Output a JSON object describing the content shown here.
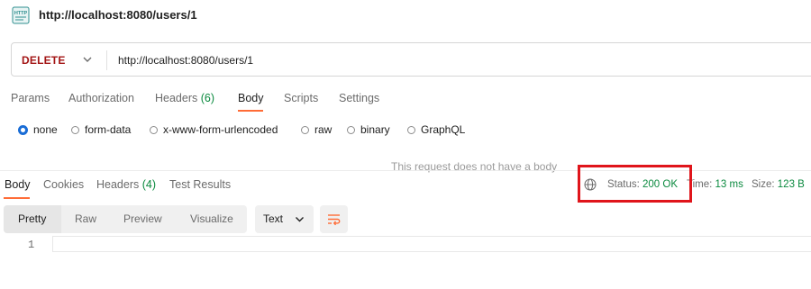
{
  "title": "http://localhost:8080/users/1",
  "request": {
    "method": "DELETE",
    "url": "http://localhost:8080/users/1",
    "tabs": {
      "params": "Params",
      "authorization": "Authorization",
      "headers_label": "Headers",
      "headers_count": "(6)",
      "body": "Body",
      "scripts": "Scripts",
      "settings": "Settings"
    },
    "body_types": [
      "none",
      "form-data",
      "x-www-form-urlencoded",
      "raw",
      "binary",
      "GraphQL"
    ],
    "no_body_message": "This request does not have a body"
  },
  "response": {
    "tabs": {
      "body": "Body",
      "cookies": "Cookies",
      "headers_label": "Headers",
      "headers_count": "(4)",
      "test_results": "Test Results"
    },
    "status_label": "Status:",
    "status_value": "200 OK",
    "time_label": "Time:",
    "time_value": "13 ms",
    "size_label": "Size:",
    "size_value": "123 B",
    "views": [
      "Pretty",
      "Raw",
      "Preview",
      "Visualize"
    ],
    "format": "Text",
    "line_number": "1"
  },
  "colors": {
    "accent": "#ff6c37",
    "method_delete": "#a31515",
    "success": "#0b8a3f",
    "radio_selected": "#1a6dd6",
    "highlight_box": "#e0151b"
  },
  "icons": [
    "http-file-icon",
    "chevron-down-icon",
    "globe-icon",
    "wrap-lines-icon"
  ]
}
